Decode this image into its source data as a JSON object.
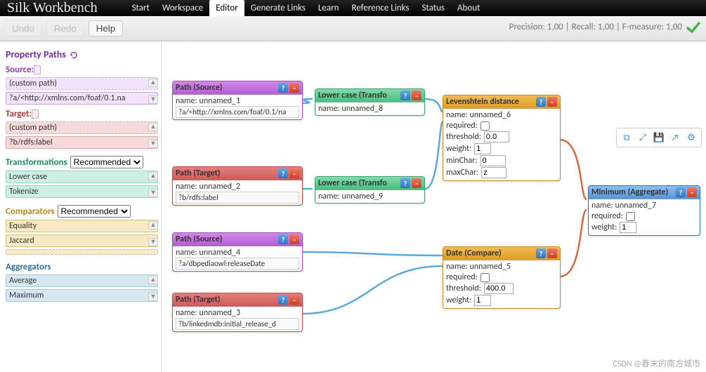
{
  "brand": "Silk Workbench",
  "tabs": [
    "Start",
    "Workspace",
    "Editor",
    "Generate Links",
    "Learn",
    "Reference Links",
    "Status",
    "About"
  ],
  "active_tab": 2,
  "toolbar": {
    "undo": "Undo",
    "redo": "Redo",
    "help": "Help"
  },
  "metrics": "Precision: 1,00 | Recall: 1,00 | F-measure: 1,00",
  "sidebar": {
    "prop_paths": "Property Paths",
    "source_label": "Source:",
    "source_items": [
      "(custom path)",
      "?a/<http://xmlns.com/foaf/0.1.na"
    ],
    "target_label": "Target:",
    "target_items": [
      "(custom path)",
      "?b/rdfs:label"
    ],
    "transformations": {
      "title": "Transformations",
      "select": "Recommended",
      "items": [
        "Lower case",
        "Tokenize"
      ]
    },
    "comparators": {
      "title": "Comparators",
      "select": "Recommended",
      "items": [
        "Equality",
        "Jaccard"
      ]
    },
    "aggregators": {
      "title": "Aggregators",
      "items": [
        "Average",
        "Maximum"
      ]
    }
  },
  "nodes": {
    "p1": {
      "title": "Path (Source)",
      "name": "name: unnamed_1",
      "path": "?a/<http://xmlns.com/foaf/0.1/na"
    },
    "p2": {
      "title": "Path (Target)",
      "name": "name: unnamed_2",
      "path": "?b/rdfs:label"
    },
    "p3": {
      "title": "Path (Source)",
      "name": "name: unnamed_4",
      "path": "?a/dbpediaowl:releaseDate"
    },
    "p4": {
      "title": "Path (Target)",
      "name": "name: unnamed_3",
      "path": "?b/linkedmdb:initial_release_d"
    },
    "t1": {
      "title": "Lower case (Transfo",
      "name": "name: unnamed_8"
    },
    "t2": {
      "title": "Lower case (Transfo",
      "name": "name: unnamed_9"
    },
    "c1": {
      "title": "Levenshtein distance",
      "name": "name: unnamed_6",
      "required": "required:",
      "threshold": "threshold:",
      "threshold_v": "0.0",
      "weight": "weight:",
      "weight_v": "1",
      "min": "minChar:",
      "min_v": "0",
      "max": "maxChar:",
      "max_v": "z"
    },
    "c2": {
      "title": "Date (Compare)",
      "name": "name: unnamed_5",
      "required": "required:",
      "threshold": "threshold:",
      "threshold_v": "400.0",
      "weight": "weight:",
      "weight_v": "1"
    },
    "ag": {
      "title": "Minimum (Aggregate)",
      "name": "name: unnamed_7",
      "required": "required:",
      "weight": "weight:",
      "weight_v": "1"
    }
  },
  "sidebtn_names": [
    "copy",
    "fullscreen",
    "save",
    "export",
    "settings"
  ],
  "watermark": "CSDN @春末的南方城市"
}
